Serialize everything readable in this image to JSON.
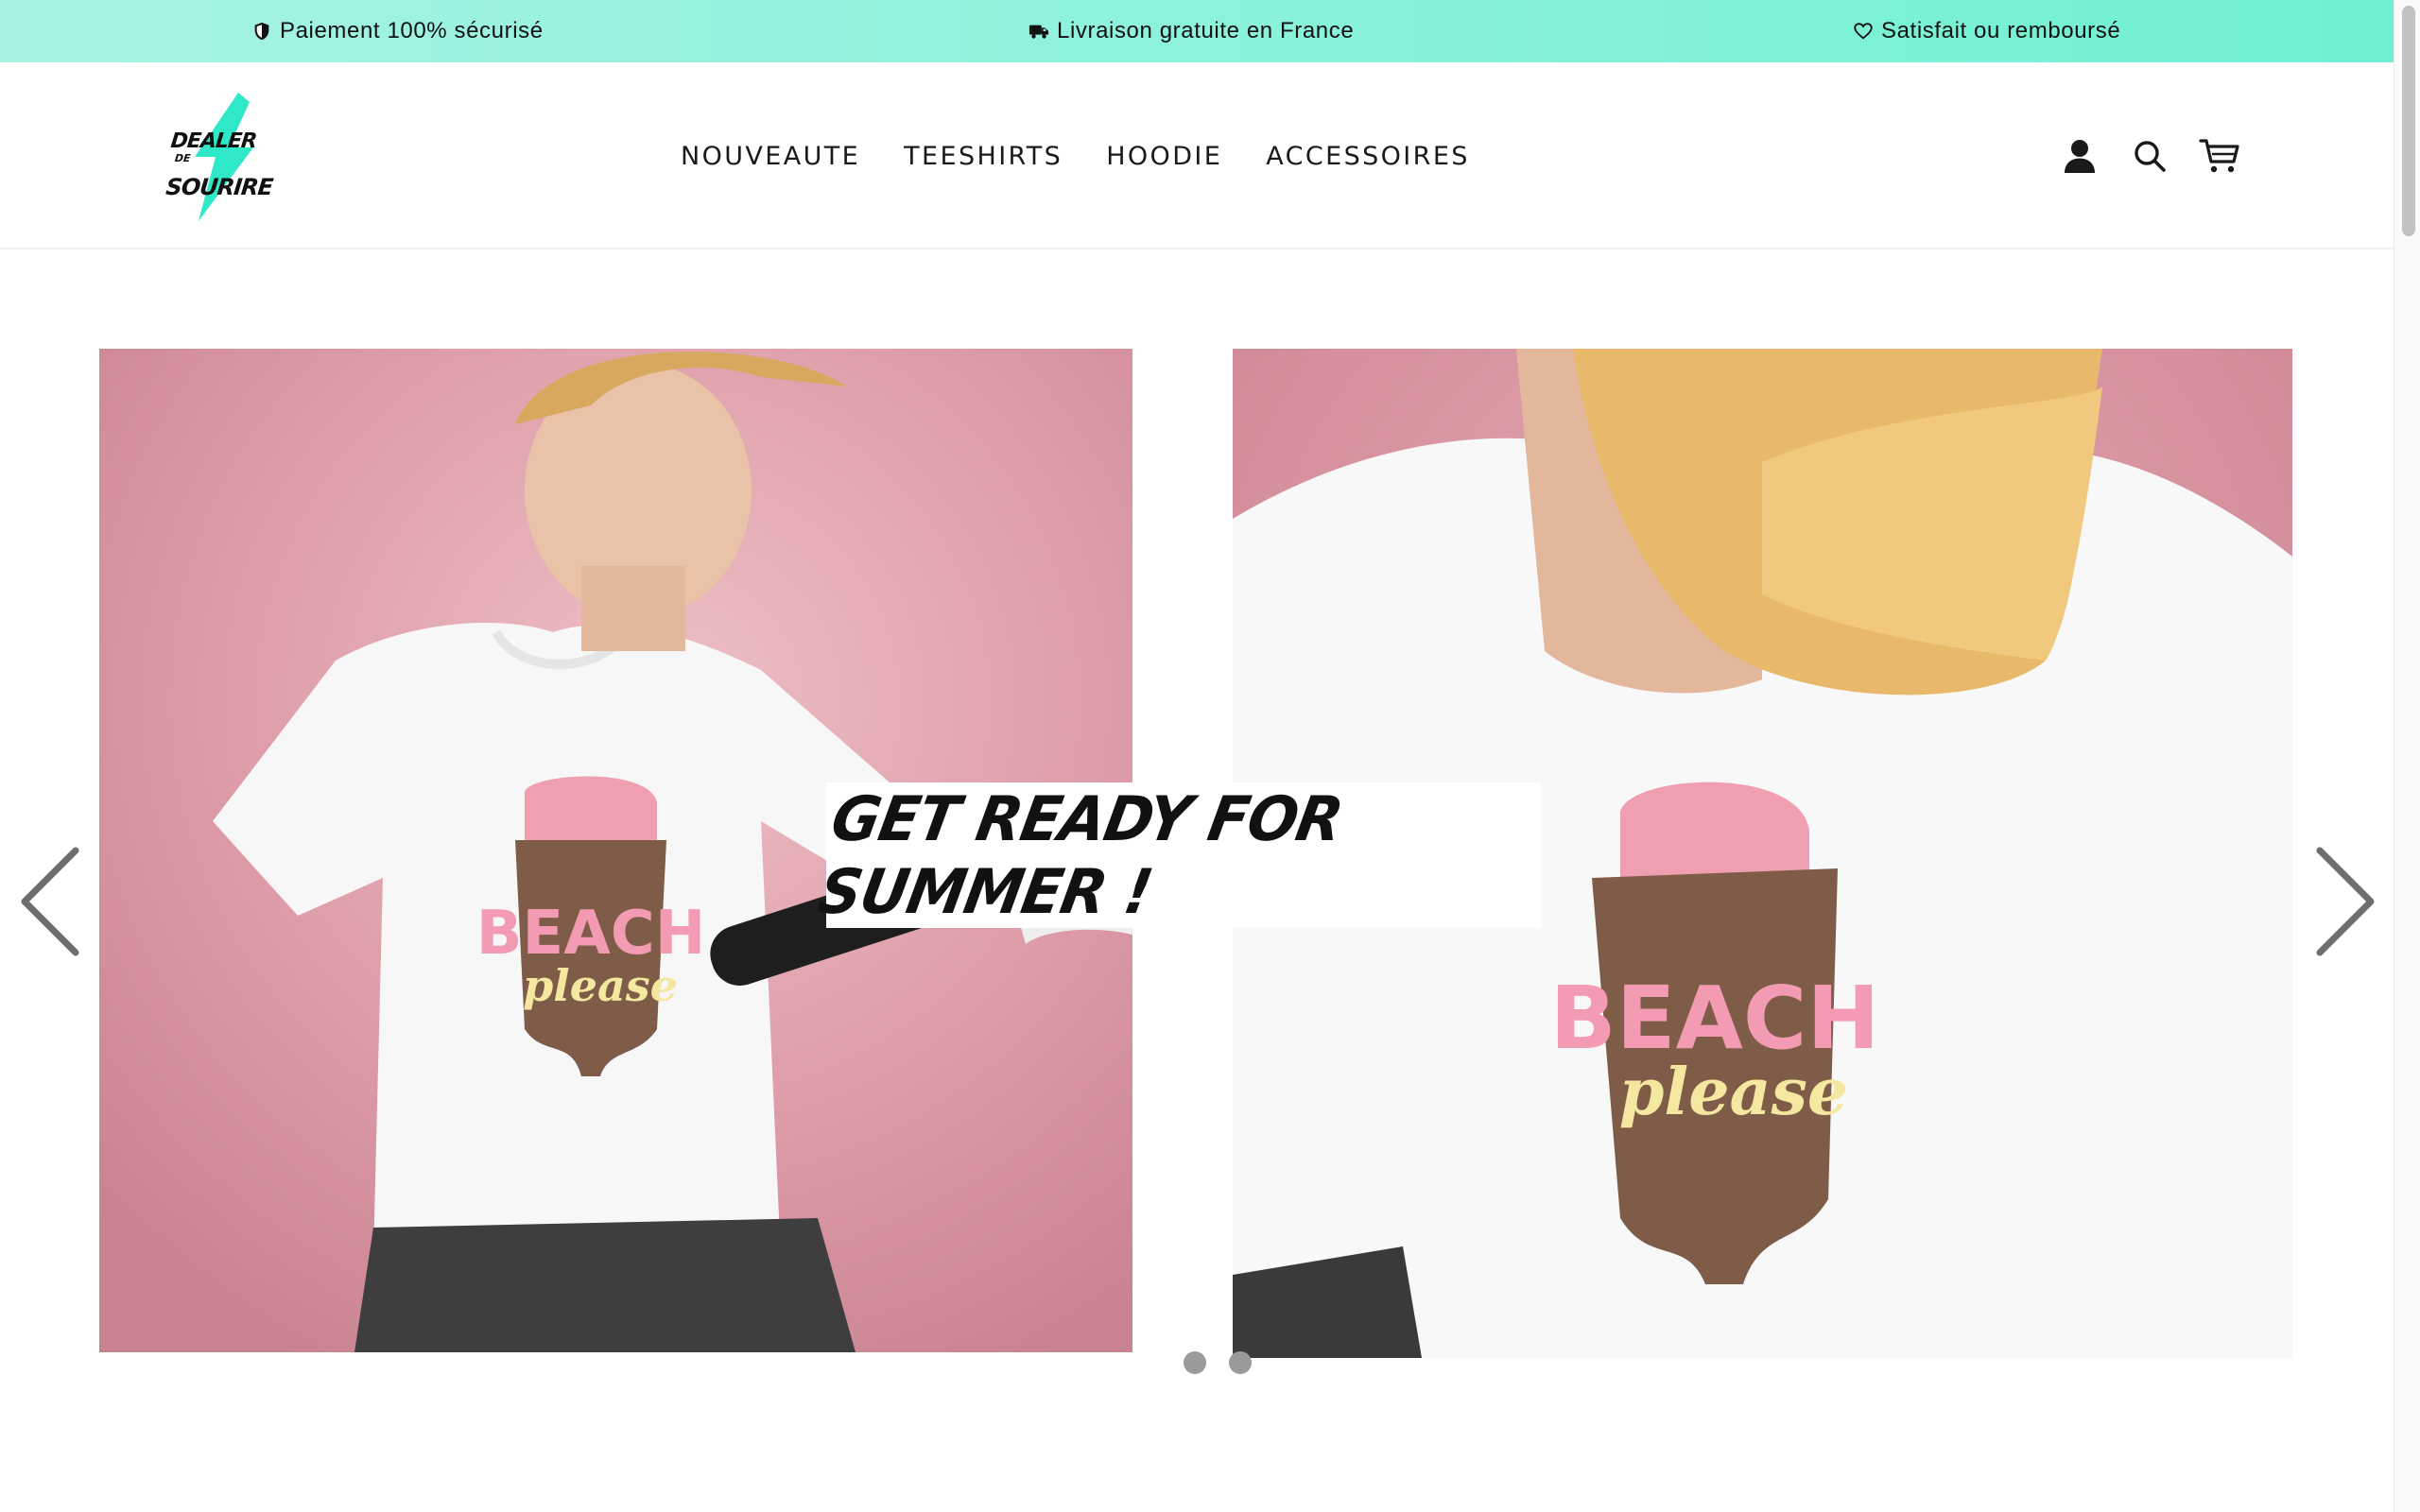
{
  "announcements": [
    {
      "icon": "shield-icon",
      "text": "Paiement 100% sécurisé"
    },
    {
      "icon": "truck-icon",
      "text": "Livraison gratuite en France"
    },
    {
      "icon": "heart-icon",
      "text": "Satisfait ou remboursé"
    }
  ],
  "logo": {
    "line1": "DEALER",
    "line2": "DE",
    "line3": "SOURIRE"
  },
  "nav": [
    "NOUVEAUTE",
    "TEESHIRTS",
    "HOODIE",
    "ACCESSOIRES"
  ],
  "header_icons": [
    "account-icon",
    "search-icon",
    "cart-icon"
  ],
  "slider": {
    "caption": "GET READY FOR SUMMER !",
    "tshirt_print": {
      "word1": "BEACH",
      "word2": "please"
    },
    "slide_count": 2,
    "active_slide": 1
  },
  "colors": {
    "topbar_start": "#a6f3e2",
    "topbar_end": "#6ff0d2",
    "accent": "#2ee8c7",
    "photo_background": "#d99aa5"
  }
}
